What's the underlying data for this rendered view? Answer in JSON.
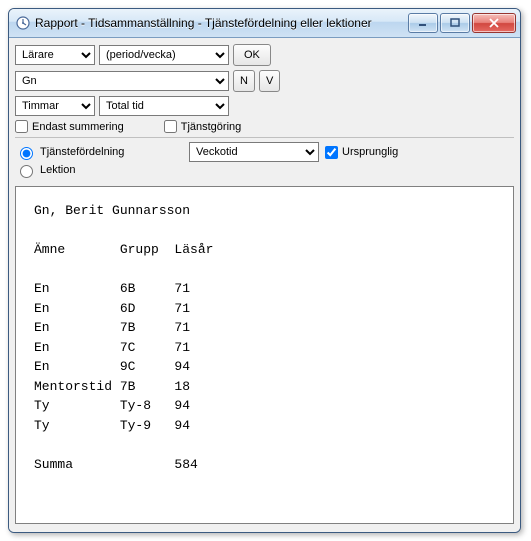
{
  "window": {
    "title": "Rapport - Tidsammanställning - Tjänstefördelning eller lektioner"
  },
  "toolbar1": {
    "combo1": "Lärare",
    "combo2": "(period/vecka)",
    "ok": "OK"
  },
  "toolbar2": {
    "person": "Gn",
    "btnN": "N",
    "btnV": "V"
  },
  "toolbar3": {
    "unit": "Timmar",
    "scope": "Total tid"
  },
  "checks": {
    "endast": "Endast summering",
    "tjanst": "Tjänstgöring"
  },
  "radios": {
    "tjanstef": "Tjänstefördelning",
    "lektion": "Lektion",
    "veckotid": "Veckotid",
    "ursprunglig": "Ursprunglig"
  },
  "report": {
    "header": "Gn, Berit Gunnarsson",
    "col1": "Ämne",
    "col2": "Grupp",
    "col3": "Läsår",
    "rows": [
      {
        "a": "En",
        "g": "6B",
        "l": "71"
      },
      {
        "a": "En",
        "g": "6D",
        "l": "71"
      },
      {
        "a": "En",
        "g": "7B",
        "l": "71"
      },
      {
        "a": "En",
        "g": "7C",
        "l": "71"
      },
      {
        "a": "En",
        "g": "9C",
        "l": "94"
      },
      {
        "a": "Mentorstid",
        "g": "7B",
        "l": "18"
      },
      {
        "a": "Ty",
        "g": "Ty-8",
        "l": "94"
      },
      {
        "a": "Ty",
        "g": "Ty-9",
        "l": "94"
      }
    ],
    "sumLabel": "Summa",
    "sumValue": "584"
  }
}
